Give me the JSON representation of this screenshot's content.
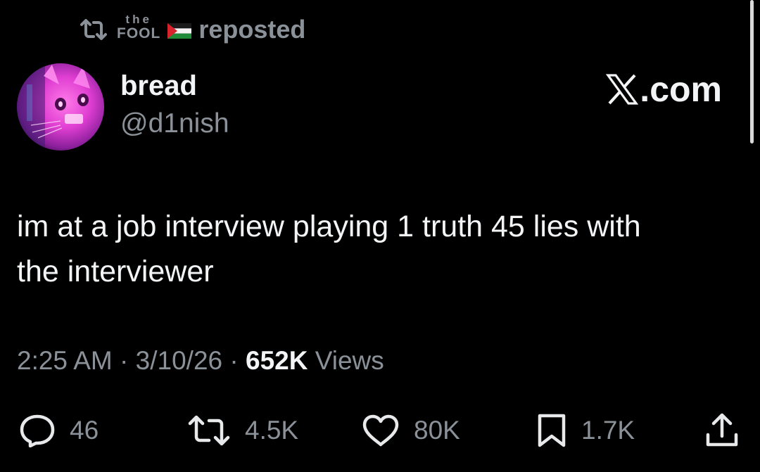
{
  "repost": {
    "icon": "repost-icon",
    "reposter_small": "the",
    "reposter_big": "FOOL",
    "flag_icon": "palestine-flag-icon",
    "label": "reposted"
  },
  "author": {
    "avatar": "cat-avatar",
    "name": "bread",
    "handle": "@d1nish"
  },
  "brand": {
    "icon": "x-logo-icon",
    "label": ".com"
  },
  "tweet": {
    "line1": "im at a job interview playing 1 truth 45 lies with",
    "line2": "the interviewer"
  },
  "meta": {
    "time": "2:25 AM",
    "sep1": " · ",
    "date": "3/10/26",
    "sep2": " · ",
    "views_count": "652K",
    "views_label": "Views"
  },
  "actions": {
    "reply": {
      "icon": "reply-icon",
      "count": "46"
    },
    "repost": {
      "icon": "repost-icon",
      "count": "4.5K"
    },
    "like": {
      "icon": "heart-icon",
      "count": "80K"
    },
    "bookmark": {
      "icon": "bookmark-icon",
      "count": "1.7K"
    },
    "share": {
      "icon": "share-icon"
    }
  },
  "colors": {
    "background": "#000000",
    "text": "#f2f4f5",
    "muted": "#8b9198",
    "avatar_pink": "#e040d0"
  }
}
